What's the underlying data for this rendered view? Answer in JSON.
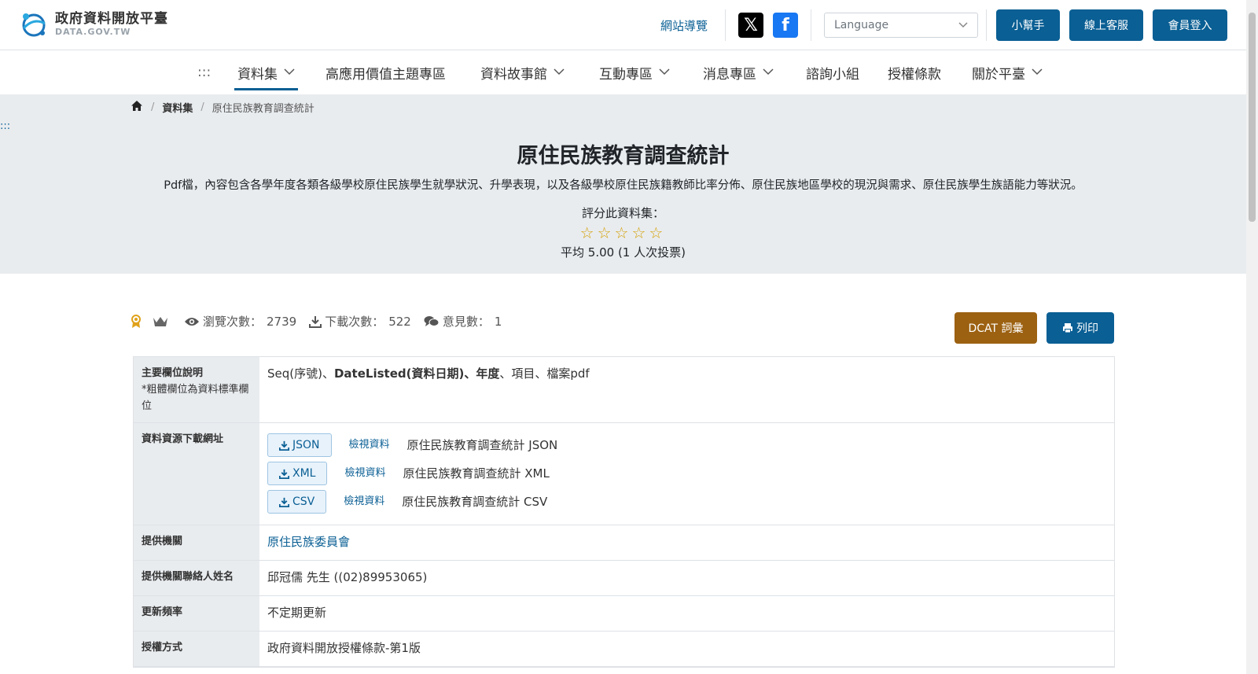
{
  "header": {
    "logo_cn": "政府資料開放平臺",
    "logo_en": "DATA.GOV.TW",
    "sitemap": "網站導覽",
    "language_placeholder": "Language",
    "helper": "小幫手",
    "support": "線上客服",
    "login": "會員登入"
  },
  "nav": {
    "access_key": ":::",
    "items": [
      {
        "label": "資料集"
      },
      {
        "label": "高應用價值主題專區"
      },
      {
        "label": "資料故事館"
      },
      {
        "label": "互動專區"
      },
      {
        "label": "消息專區"
      },
      {
        "label": "諮詢小組"
      },
      {
        "label": "授權條款"
      },
      {
        "label": "關於平臺"
      }
    ]
  },
  "breadcrumb": {
    "level1": "資料集",
    "current": "原住民族教育調查統計"
  },
  "side_access": ":::",
  "hero": {
    "title": "原住民族教育調查統計",
    "description": "Pdf檔，內容包含各學年度各類各級學校原住民族學生就學狀況、升學表現，以及各級學校原住民族籍教師比率分佈、原住民族地區學校的現況與需求、原住民族學生族語能力等狀況。",
    "rate_label": "評分此資料集：",
    "stars": "☆☆☆☆☆",
    "average": "平均 5.00 (1 人次投票)"
  },
  "stats": {
    "views_label": "瀏覽次數：",
    "views": "2739",
    "downloads_label": "下載次數：",
    "downloads": "522",
    "comments_label": "意見數：",
    "comments": "1"
  },
  "actions": {
    "dcat": "DCAT 詞彙",
    "print": "列印"
  },
  "table": {
    "fields_header": "主要欄位說明",
    "fields_note": "*粗體欄位為資料標準欄位",
    "fields_plain1": "Seq(序號)、",
    "fields_bold": "DateListed(資料日期)、年度",
    "fields_plain2": "、項目、檔案pdf",
    "resources_header": "資料資源下載網址",
    "resources": [
      {
        "format": "JSON",
        "view": "檢視資料",
        "name": "原住民族教育調查統計 JSON"
      },
      {
        "format": "XML",
        "view": "檢視資料",
        "name": "原住民族教育調查統計 XML"
      },
      {
        "format": "CSV",
        "view": "檢視資料",
        "name": "原住民族教育調查統計 CSV"
      }
    ],
    "org_header": "提供機關",
    "org": "原住民族委員會",
    "contact_header": "提供機關聯絡人姓名",
    "contact": "邱冠儒 先生 ((02)89953065)",
    "freq_header": "更新頻率",
    "freq": "不定期更新",
    "license_header": "授權方式",
    "license": "政府資料開放授權條款-第1版"
  },
  "colors": {
    "primary": "#0a5f94",
    "dcat": "#9c6111",
    "hero_bg": "#e9ecef",
    "star": "#d4a20a"
  }
}
